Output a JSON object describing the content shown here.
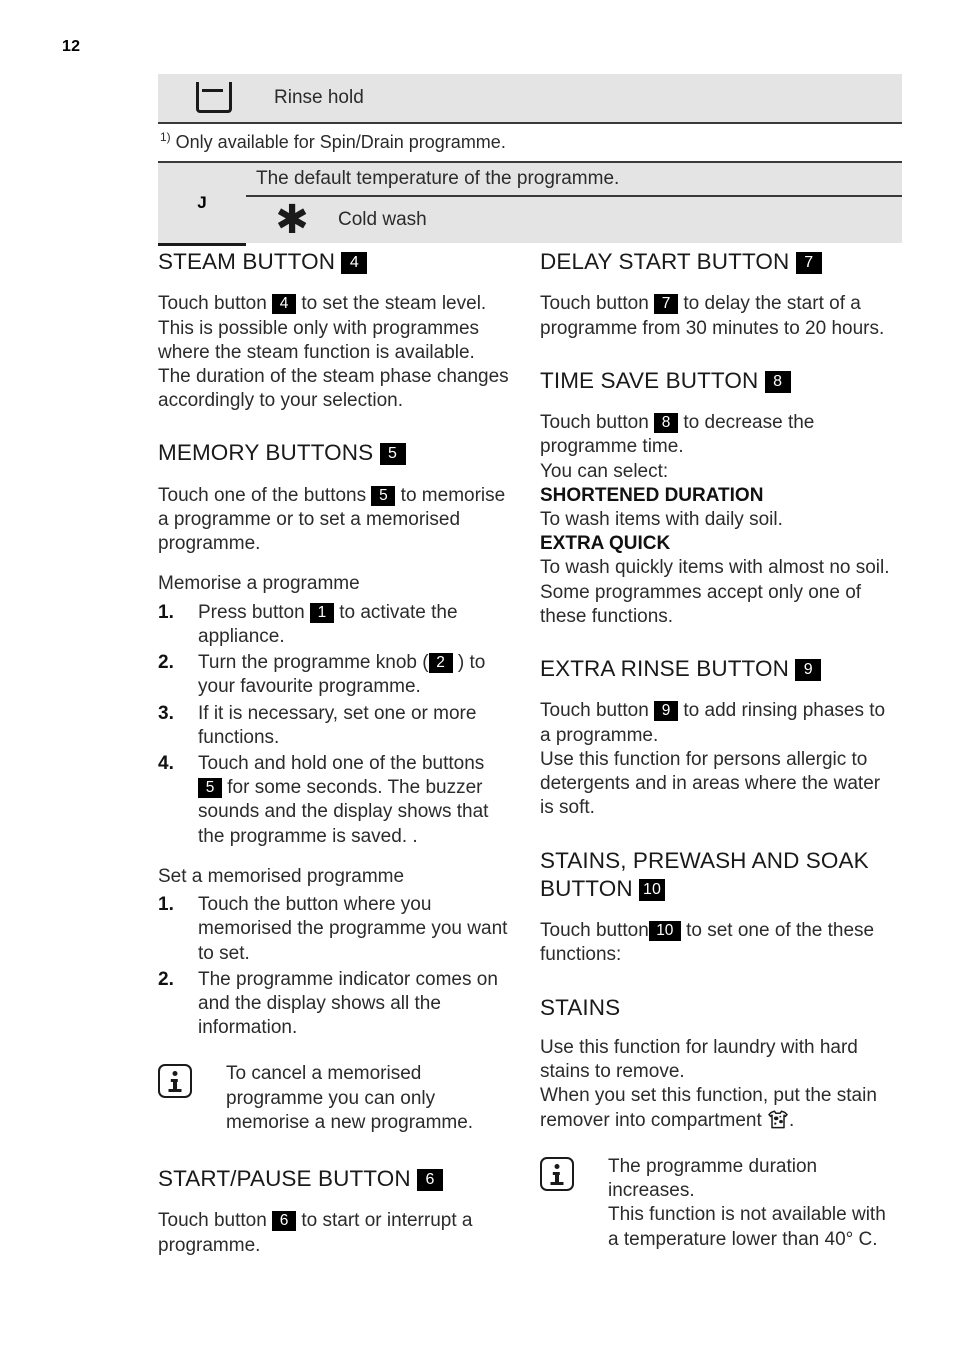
{
  "page": {
    "number": "12"
  },
  "table_rinse": {
    "icon": "rinse-hold-tub-icon",
    "label": "Rinse hold"
  },
  "footnote": {
    "marker": "1)",
    "text": " Only available for Spin/Drain programme."
  },
  "table_temperature": {
    "letter": "J",
    "default_row": "The default temperature of the programme.",
    "cold_icon": "cold-wash-asterisk-icon",
    "cold_label": "Cold wash"
  },
  "left_column": {
    "steam": {
      "heading": "STEAM BUTTON",
      "heading_badge": "4",
      "p1_a": "Touch button",
      "p1_badge": "4",
      "p1_b": "to set the steam level. This is possible only with programmes where the steam function is available. The duration of the steam phase changes accordingly to your selection."
    },
    "memory": {
      "heading": "MEMORY BUTTONS",
      "heading_badge": "5",
      "p1_a": "Touch one of the buttons",
      "p1_badge": "5",
      "p1_b": "to memorise a programme or to set a memorised programme.",
      "sub1": "Memorise a programme",
      "steps1": [
        {
          "num": "1.",
          "a": "Press button",
          "badge": "1",
          "b": "to activate the appliance."
        },
        {
          "num": "2.",
          "a": "Turn the programme knob (",
          "badge": "2",
          "b": ") to your favourite programme."
        },
        {
          "num": "3.",
          "a": "If it is necessary, set one or more functions.",
          "badge": "",
          "b": ""
        },
        {
          "num": "4.",
          "a": "Touch and hold one of the buttons",
          "badge": "5",
          "b": "for some seconds. The buzzer sounds and the display shows that the programme is saved. ."
        }
      ],
      "sub2": "Set a memorised programme",
      "steps2": [
        {
          "num": "1.",
          "a": "Touch the button where you memorised the programme you want to set.",
          "badge": "",
          "b": ""
        },
        {
          "num": "2.",
          "a": "The programme indicator comes on and the display shows all the information.",
          "badge": "",
          "b": ""
        }
      ],
      "note": "To cancel a memorised programme you can only memorise a new programme.",
      "note_icon": "info-icon"
    },
    "start_pause": {
      "heading": "START/PAUSE BUTTON",
      "heading_badge": "6",
      "p1_a": "Touch button",
      "p1_badge": "6",
      "p1_b": "to start or interrupt a programme."
    }
  },
  "right_column": {
    "delay_start": {
      "heading": "DELAY START BUTTON",
      "heading_badge": "7",
      "p1_a": "Touch button",
      "p1_badge": "7",
      "p1_b": "to delay the start of a programme from 30 minutes to 20 hours."
    },
    "time_save": {
      "heading": "TIME SAVE BUTTON",
      "heading_badge": "8",
      "p1_a": "Touch button",
      "p1_badge": "8",
      "p1_b": "to decrease the programme time.",
      "line_select": "You can select:",
      "opt1_title": "SHORTENED DURATION",
      "opt1_desc": "To wash items with daily soil.",
      "opt2_title": "EXTRA QUICK",
      "opt2_desc": "To wash quickly items with almost no soil.",
      "closing": "Some programmes accept only one of these functions."
    },
    "extra_rinse": {
      "heading": "EXTRA RINSE BUTTON",
      "heading_badge": "9",
      "p1_a": "Touch button",
      "p1_badge": "9",
      "p1_b": "to add rinsing phases to a programme.",
      "p2": "Use this function for persons allergic to detergents and in areas where the water is soft."
    },
    "stains_prewash_soak": {
      "heading_line1": "STAINS, PREWASH AND SOAK",
      "heading_line2": "BUTTON",
      "heading_badge": "10",
      "p1_a": "Touch button",
      "p1_badge": "10",
      "p1_b": "to set one of the these functions:"
    },
    "stains": {
      "heading": "STAINS",
      "p1": "Use this function for laundry with hard stains to remove.",
      "p2_a": "When you set this function, put the stain remover into compartment",
      "p2_icon": "stained-shirt-icon",
      "p2_b": ".",
      "note": "The programme duration increases.\nThis function is not available with a temperature lower than 40° C.",
      "note_icon": "info-icon"
    }
  }
}
